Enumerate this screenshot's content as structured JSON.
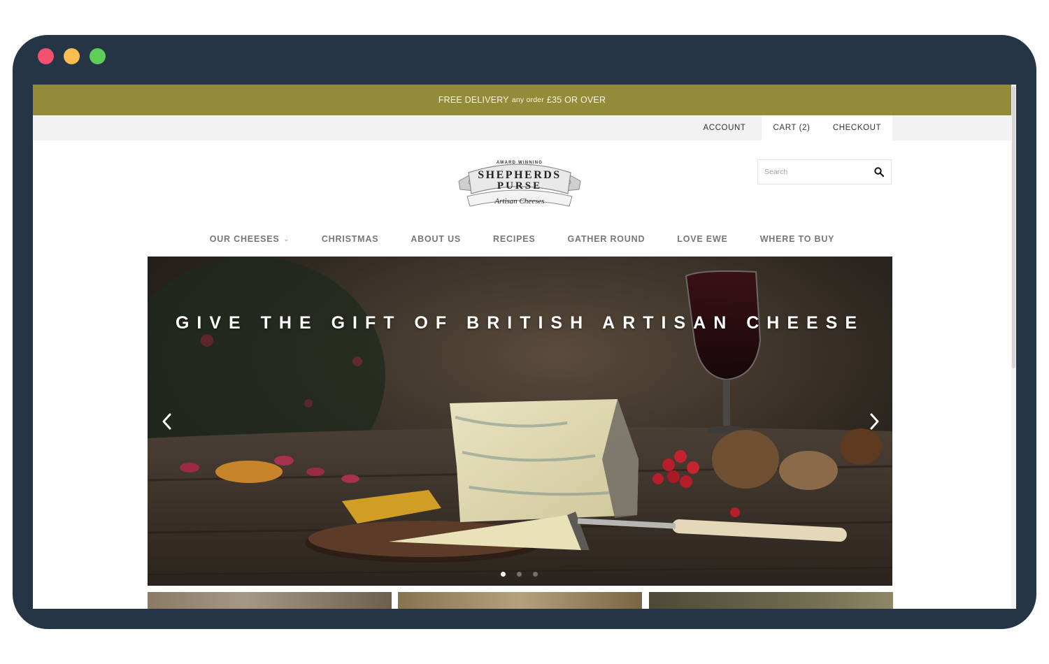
{
  "window": {
    "controls": [
      "close",
      "minimize",
      "maximize"
    ]
  },
  "promo": {
    "part1": "FREE DELIVERY",
    "part2": "any order",
    "part3": "£35 OR OVER",
    "color": "#938b39"
  },
  "top_links": {
    "account": "ACCOUNT",
    "cart": "CART (2)",
    "checkout": "CHECKOUT"
  },
  "logo": {
    "top": "AWARD WINNING",
    "line1": "SHEPHERDS",
    "line2": "PURSE",
    "tagline": "Artisan Cheeses"
  },
  "search": {
    "placeholder": "Search",
    "icon": "search-icon"
  },
  "nav": {
    "items": [
      {
        "label": "OUR CHEESES",
        "has_dropdown": true
      },
      {
        "label": "CHRISTMAS"
      },
      {
        "label": "ABOUT US"
      },
      {
        "label": "RECIPES"
      },
      {
        "label": "GATHER ROUND"
      },
      {
        "label": "LOVE EWE"
      },
      {
        "label": "WHERE TO BUY"
      }
    ]
  },
  "hero": {
    "title": "GIVE THE GIFT OF BRITISH ARTISAN CHEESE",
    "prev_icon": "chevron-left-icon",
    "next_icon": "chevron-right-icon",
    "slides": 3,
    "active_slide": 1
  }
}
